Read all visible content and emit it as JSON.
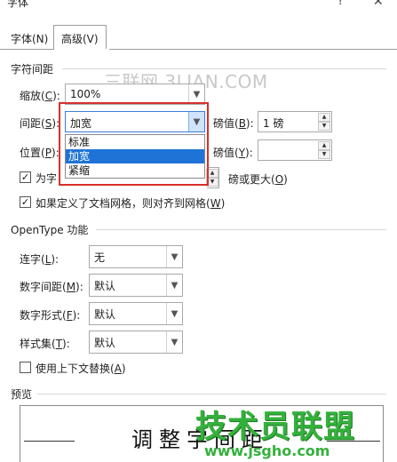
{
  "window": {
    "title": "字体",
    "help_label": "?",
    "close_label": "✕"
  },
  "tabs": [
    {
      "label": "字体(N)",
      "underline": "N",
      "active": false
    },
    {
      "label": "高级(V)",
      "underline": "V",
      "active": true
    }
  ],
  "watermark": "三联网 3LIAN.COM",
  "char_spacing": {
    "heading": "字符间距",
    "scale": {
      "label_main": "缩放(",
      "label_key": "C",
      "label_tail": "):",
      "value": "100%"
    },
    "spacing": {
      "label_main": "间距(",
      "label_key": "S",
      "label_tail": "):",
      "value": "加宽",
      "points_label_main": "磅值(",
      "points_label_key": "B",
      "points_label_tail": "):",
      "points_value": "1 磅"
    },
    "position": {
      "label_main": "位置(",
      "label_key": "P",
      "label_tail": "):",
      "points_label_main": "磅值(",
      "points_label_key": "Y",
      "points_label_tail": "):",
      "points_value": ""
    },
    "dropdown_options": [
      "标准",
      "加宽",
      "紧缩"
    ],
    "dropdown_selected": "加宽",
    "kerning": {
      "checked": true,
      "label_visible": "为字",
      "label_tail_main": "磅或更大(",
      "label_tail_key": "O",
      "label_tail_end": ")"
    },
    "grid": {
      "checked": true,
      "label_main": "如果定义了文档网格，则对齐到网格(",
      "label_key": "W",
      "label_end": ")"
    }
  },
  "opentype": {
    "heading": "OpenType 功能",
    "ligatures": {
      "label_main": "连字(",
      "label_key": "L",
      "label_tail": "):",
      "value": "无"
    },
    "number_spacing": {
      "label_main": "数字间距(",
      "label_key": "M",
      "label_tail": "):",
      "value": "默认"
    },
    "number_forms": {
      "label_main": "数字形式(",
      "label_key": "F",
      "label_tail": "):",
      "value": "默认"
    },
    "stylistic_sets": {
      "label_main": "样式集(",
      "label_key": "T",
      "label_tail": "):",
      "value": "默认"
    },
    "contextual": {
      "checked": false,
      "label_main": "使用上下文替换(",
      "label_key": "A",
      "label_end": ")"
    }
  },
  "preview": {
    "heading": "预览",
    "text": "调整字间距"
  },
  "logo": {
    "main": "技术员联盟",
    "sub": "www.jsgho.com"
  },
  "colors": {
    "highlight": "#d8302b",
    "selection": "#1f73d6",
    "logo_green": "#34b13c"
  }
}
